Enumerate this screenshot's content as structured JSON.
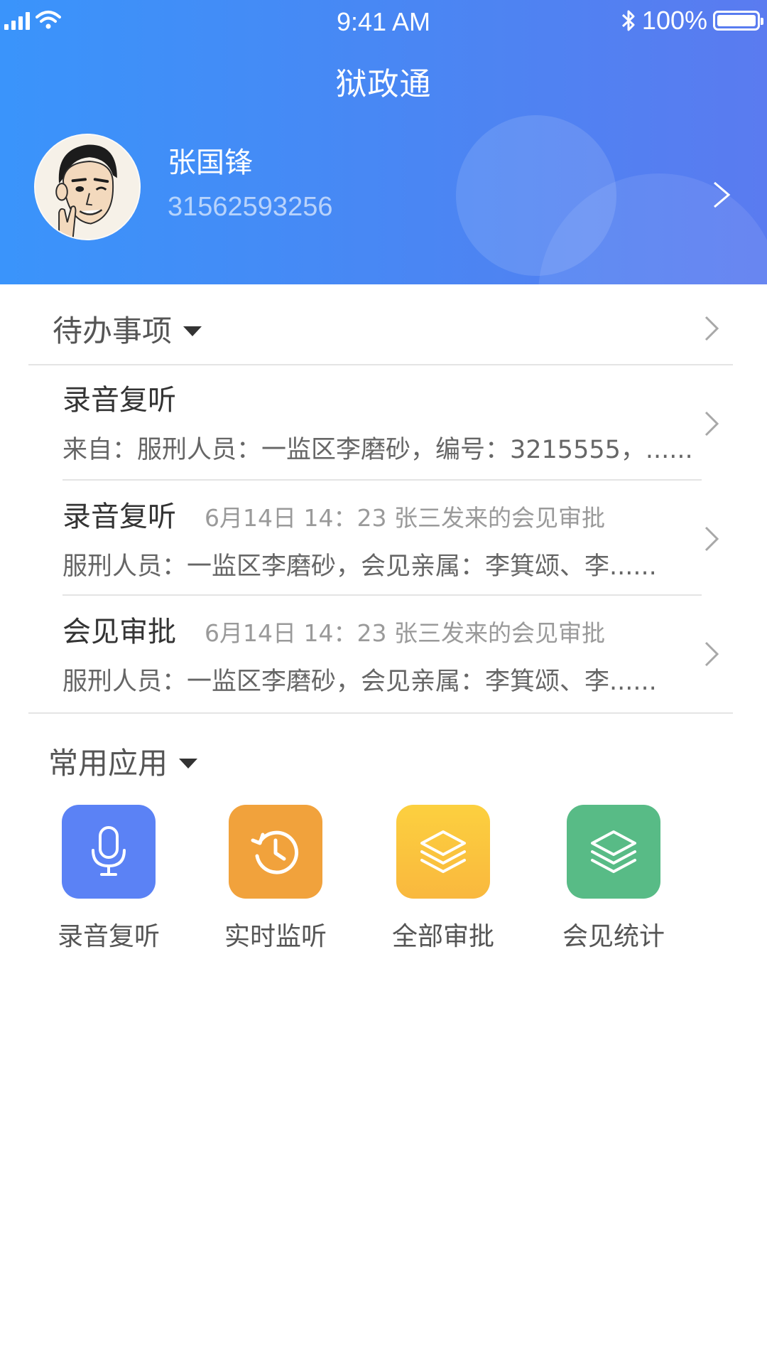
{
  "status_bar": {
    "time": "9:41 AM",
    "battery": "100%"
  },
  "header": {
    "title": "狱政通"
  },
  "profile": {
    "name": "张国锋",
    "id": "31562593256"
  },
  "todo": {
    "title": "待办事项",
    "items": [
      {
        "title": "录音复听",
        "meta": "",
        "desc": "来自：服刑人员：一监区李磨砂，编号：3215555，......"
      },
      {
        "title": "录音复听",
        "meta": "6月14日  14：23  张三发来的会见审批",
        "desc": "服刑人员：一监区李磨砂，会见亲属：李箕颂、李......"
      },
      {
        "title": "会见审批",
        "meta": "6月14日  14：23  张三发来的会见审批",
        "desc": "服刑人员：一监区李磨砂，会见亲属：李箕颂、李......"
      }
    ]
  },
  "apps": {
    "title": "常用应用",
    "items": [
      {
        "label": "录音复听",
        "icon": "microphone-icon",
        "color": "#5b82f5"
      },
      {
        "label": "实时监听",
        "icon": "history-icon",
        "color": "#f1a23c"
      },
      {
        "label": "全部审批",
        "icon": "layers-icon",
        "color": "#fbbf3d"
      },
      {
        "label": "会见统计",
        "icon": "layers-icon",
        "color": "#58bb86"
      }
    ]
  }
}
